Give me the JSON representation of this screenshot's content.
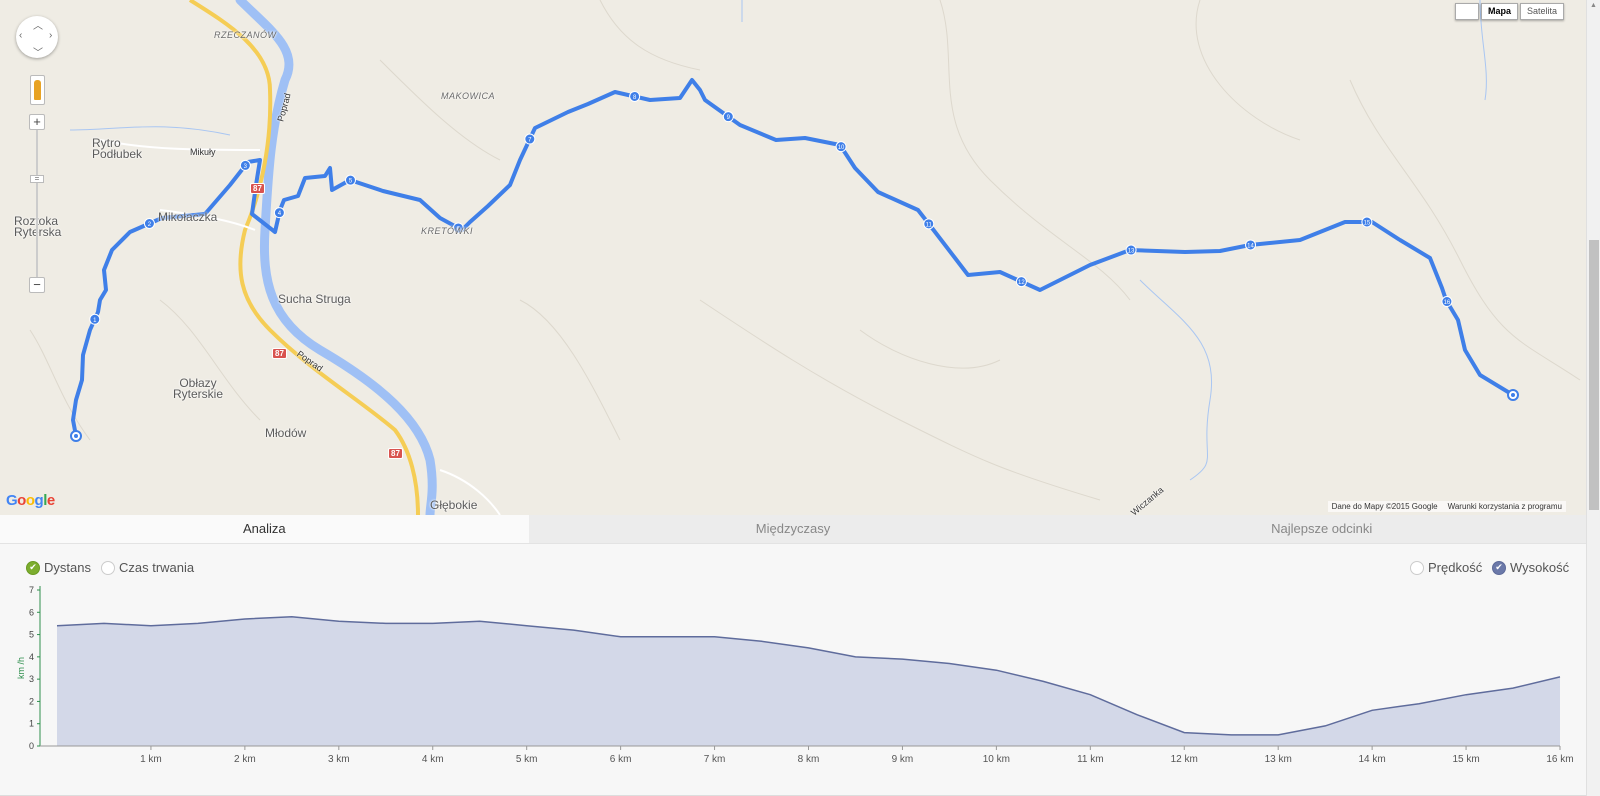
{
  "map": {
    "places": [
      {
        "text": "RZECZANÓW",
        "cls": "small"
      },
      {
        "text": "MAKOWICA",
        "cls": "small"
      },
      {
        "text": "Rytro\nPodłubek",
        "cls": ""
      },
      {
        "text": "Mikuły",
        "cls": "tiny"
      },
      {
        "text": "Roztoka\nRyterska",
        "cls": ""
      },
      {
        "text": "Mikołaczka",
        "cls": ""
      },
      {
        "text": "KRETÓWKI",
        "cls": "small"
      },
      {
        "text": "Sucha Struga",
        "cls": ""
      },
      {
        "text": "Obłazy\nRyterskie",
        "cls": ""
      },
      {
        "text": "Młodów",
        "cls": ""
      },
      {
        "text": "Głębokie",
        "cls": ""
      },
      {
        "text": "Poprad",
        "cls": "tiny"
      },
      {
        "text": "Poprad",
        "cls": "tiny"
      },
      {
        "text": "Wiczanka",
        "cls": "tiny"
      }
    ],
    "road_shields": [
      "87",
      "87",
      "87"
    ],
    "km_markers": [
      "1",
      "2",
      "3",
      "4",
      "5",
      "6",
      "7",
      "8",
      "9",
      "10",
      "11",
      "12",
      "13",
      "14",
      "15",
      "16"
    ],
    "map_type": {
      "map_label": "Mapa",
      "satellite_label": "Satelita",
      "active": "Mapa"
    },
    "zoom_in": "+",
    "zoom_out": "−",
    "google_logo": "Google",
    "attribution": "Dane do Mapy ©2015 Google",
    "terms": "Warunki korzystania z programu",
    "route_color": "#3f7fe8",
    "river_color": "#9fc0f5",
    "road_color": "#f5cd55"
  },
  "tabs": [
    {
      "label": "Analiza",
      "active": true
    },
    {
      "label": "Międzyczasy",
      "active": false
    },
    {
      "label": "Najlepsze odcinki",
      "active": false
    }
  ],
  "options": {
    "distance": {
      "label": "Dystans",
      "checked": true
    },
    "duration": {
      "label": "Czas trwania",
      "checked": false
    },
    "speed": {
      "label": "Prędkość",
      "checked": false
    },
    "altitude": {
      "label": "Wysokość",
      "checked": true
    }
  },
  "chart_data": {
    "type": "area",
    "ylabel": "km /h",
    "ylim": [
      0,
      7
    ],
    "yticks": [
      "0",
      "1",
      "2",
      "3",
      "4",
      "5",
      "6",
      "7"
    ],
    "xlim": [
      0,
      16
    ],
    "xticks": [
      "1 km",
      "2 km",
      "3 km",
      "4 km",
      "5 km",
      "6 km",
      "7 km",
      "8 km",
      "9 km",
      "10 km",
      "11 km",
      "12 km",
      "13 km",
      "14 km",
      "15 km",
      "16 km"
    ],
    "x": [
      0,
      0.5,
      1,
      1.5,
      2,
      2.5,
      3,
      3.5,
      4,
      4.5,
      5,
      5.5,
      6,
      6.5,
      7,
      7.5,
      8,
      8.5,
      9,
      9.5,
      10,
      10.5,
      11,
      11.5,
      12,
      12.5,
      13,
      13.5,
      14,
      14.5,
      15,
      15.5,
      16
    ],
    "values": [
      5.4,
      5.5,
      5.4,
      5.5,
      5.7,
      5.8,
      5.6,
      5.5,
      5.5,
      5.6,
      5.4,
      5.2,
      4.9,
      4.9,
      4.9,
      4.7,
      4.4,
      4.0,
      3.9,
      3.7,
      3.4,
      2.9,
      2.3,
      1.4,
      0.6,
      0.5,
      0.5,
      0.9,
      1.6,
      1.9,
      2.3,
      2.6,
      3.1
    ],
    "fill_color": "#d3d8e8",
    "line_color": "#5f6c9c",
    "axis_color": "#2f8f4e"
  }
}
